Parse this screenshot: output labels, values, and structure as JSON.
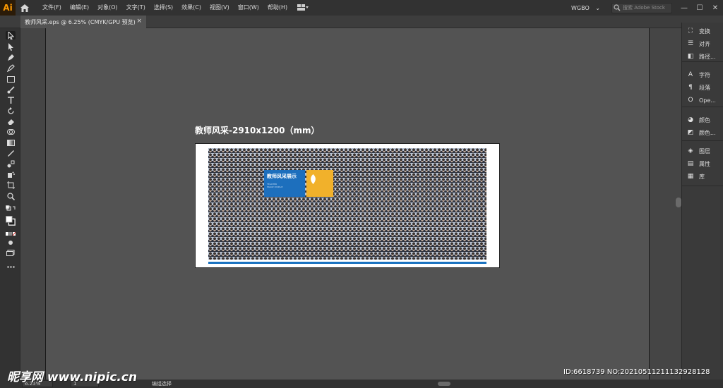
{
  "app": {
    "logo": "Ai"
  },
  "menu": [
    "文件(F)",
    "编辑(E)",
    "对象(O)",
    "文字(T)",
    "选择(S)",
    "效果(C)",
    "视图(V)",
    "窗口(W)",
    "帮助(H)"
  ],
  "workspace": {
    "label": "WGBO",
    "chevron": "⌄"
  },
  "search": {
    "placeholder": "搜索 Adobe Stock"
  },
  "window_controls": {
    "minimize": "—",
    "maximize": "☐",
    "close": "✕"
  },
  "tab": {
    "title": "教师风采.eps @ 6.25% (CMYK/GPU 预览)",
    "close": "×"
  },
  "artboard": {
    "label": "教师风采-2910x1200（mm）",
    "banner_title": "教师风采展示",
    "banner_sub1": "TEACHER",
    "banner_sub2": "IMAGE DISPLAY"
  },
  "panels": {
    "group1": [
      {
        "icon": "transform-icon",
        "glyph": "⛶",
        "label": "变换"
      },
      {
        "icon": "align-icon",
        "glyph": "☰",
        "label": "对齐"
      },
      {
        "icon": "pathfinder-icon",
        "glyph": "◧",
        "label": "路径..."
      }
    ],
    "group2": [
      {
        "icon": "character-icon",
        "glyph": "A",
        "label": "字符"
      },
      {
        "icon": "paragraph-icon",
        "glyph": "¶",
        "label": "段落"
      },
      {
        "icon": "opentype-icon",
        "glyph": "O",
        "label": "Ope..."
      }
    ],
    "group3": [
      {
        "icon": "color-icon",
        "glyph": "◕",
        "label": "颜色"
      },
      {
        "icon": "color-guide-icon",
        "glyph": "◩",
        "label": "颜色..."
      }
    ],
    "group4": [
      {
        "icon": "layers-icon",
        "glyph": "◈",
        "label": "图层"
      },
      {
        "icon": "properties-icon",
        "glyph": "▤",
        "label": "属性"
      },
      {
        "icon": "libraries-icon",
        "glyph": "▦",
        "label": "库"
      }
    ]
  },
  "status": {
    "zoom": "6.25%",
    "artboard_num": "1",
    "selection": "编组选择"
  },
  "watermark": "昵享网 www.nipic.cn",
  "id_tag": "ID:6618739 NO:20210511211132928128"
}
